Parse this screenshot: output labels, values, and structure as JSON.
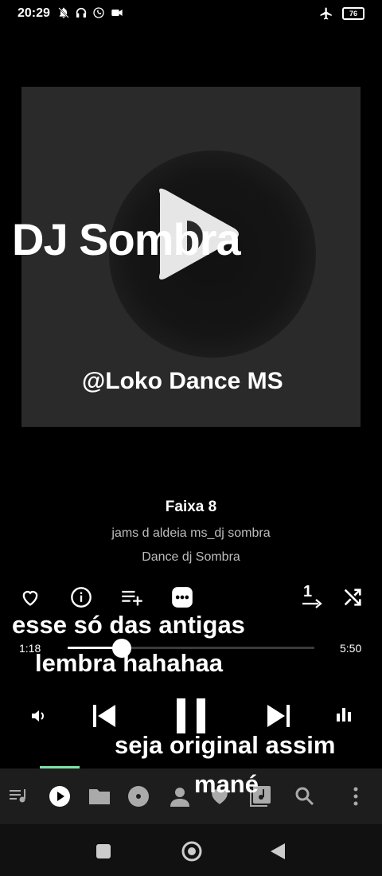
{
  "status_bar": {
    "time": "20:29",
    "battery": "76"
  },
  "album": {
    "overlay_title": "DJ Sombra",
    "overlay_handle": "@Loko Dance MS"
  },
  "track": {
    "title": "Faixa 8",
    "artist": "jams d aldeia ms_dj sombra",
    "album": "Dance dj Sombra"
  },
  "captions": {
    "line1": "esse só das antigas",
    "line2": "lembra hahahaa",
    "line3": "seja original assim",
    "line4": "mané"
  },
  "progress": {
    "elapsed": "1:18",
    "total": "5:50",
    "fraction": 0.22
  },
  "actions": {
    "repeat_badge": "1"
  },
  "icons": {
    "favorite": "heart-outline-icon",
    "info": "info-icon",
    "add_to_queue": "playlist-add-icon",
    "more": "more-icon",
    "repeat_one": "repeat-one-icon",
    "shuffle": "shuffle-icon",
    "volume": "volume-icon",
    "prev": "skip-previous-icon",
    "pause": "pause-icon",
    "next": "skip-next-icon",
    "equalizer": "equalizer-icon"
  },
  "colors": {
    "background": "#000000",
    "accent": "#7de3a7",
    "nav_background": "#1d1d1d"
  }
}
